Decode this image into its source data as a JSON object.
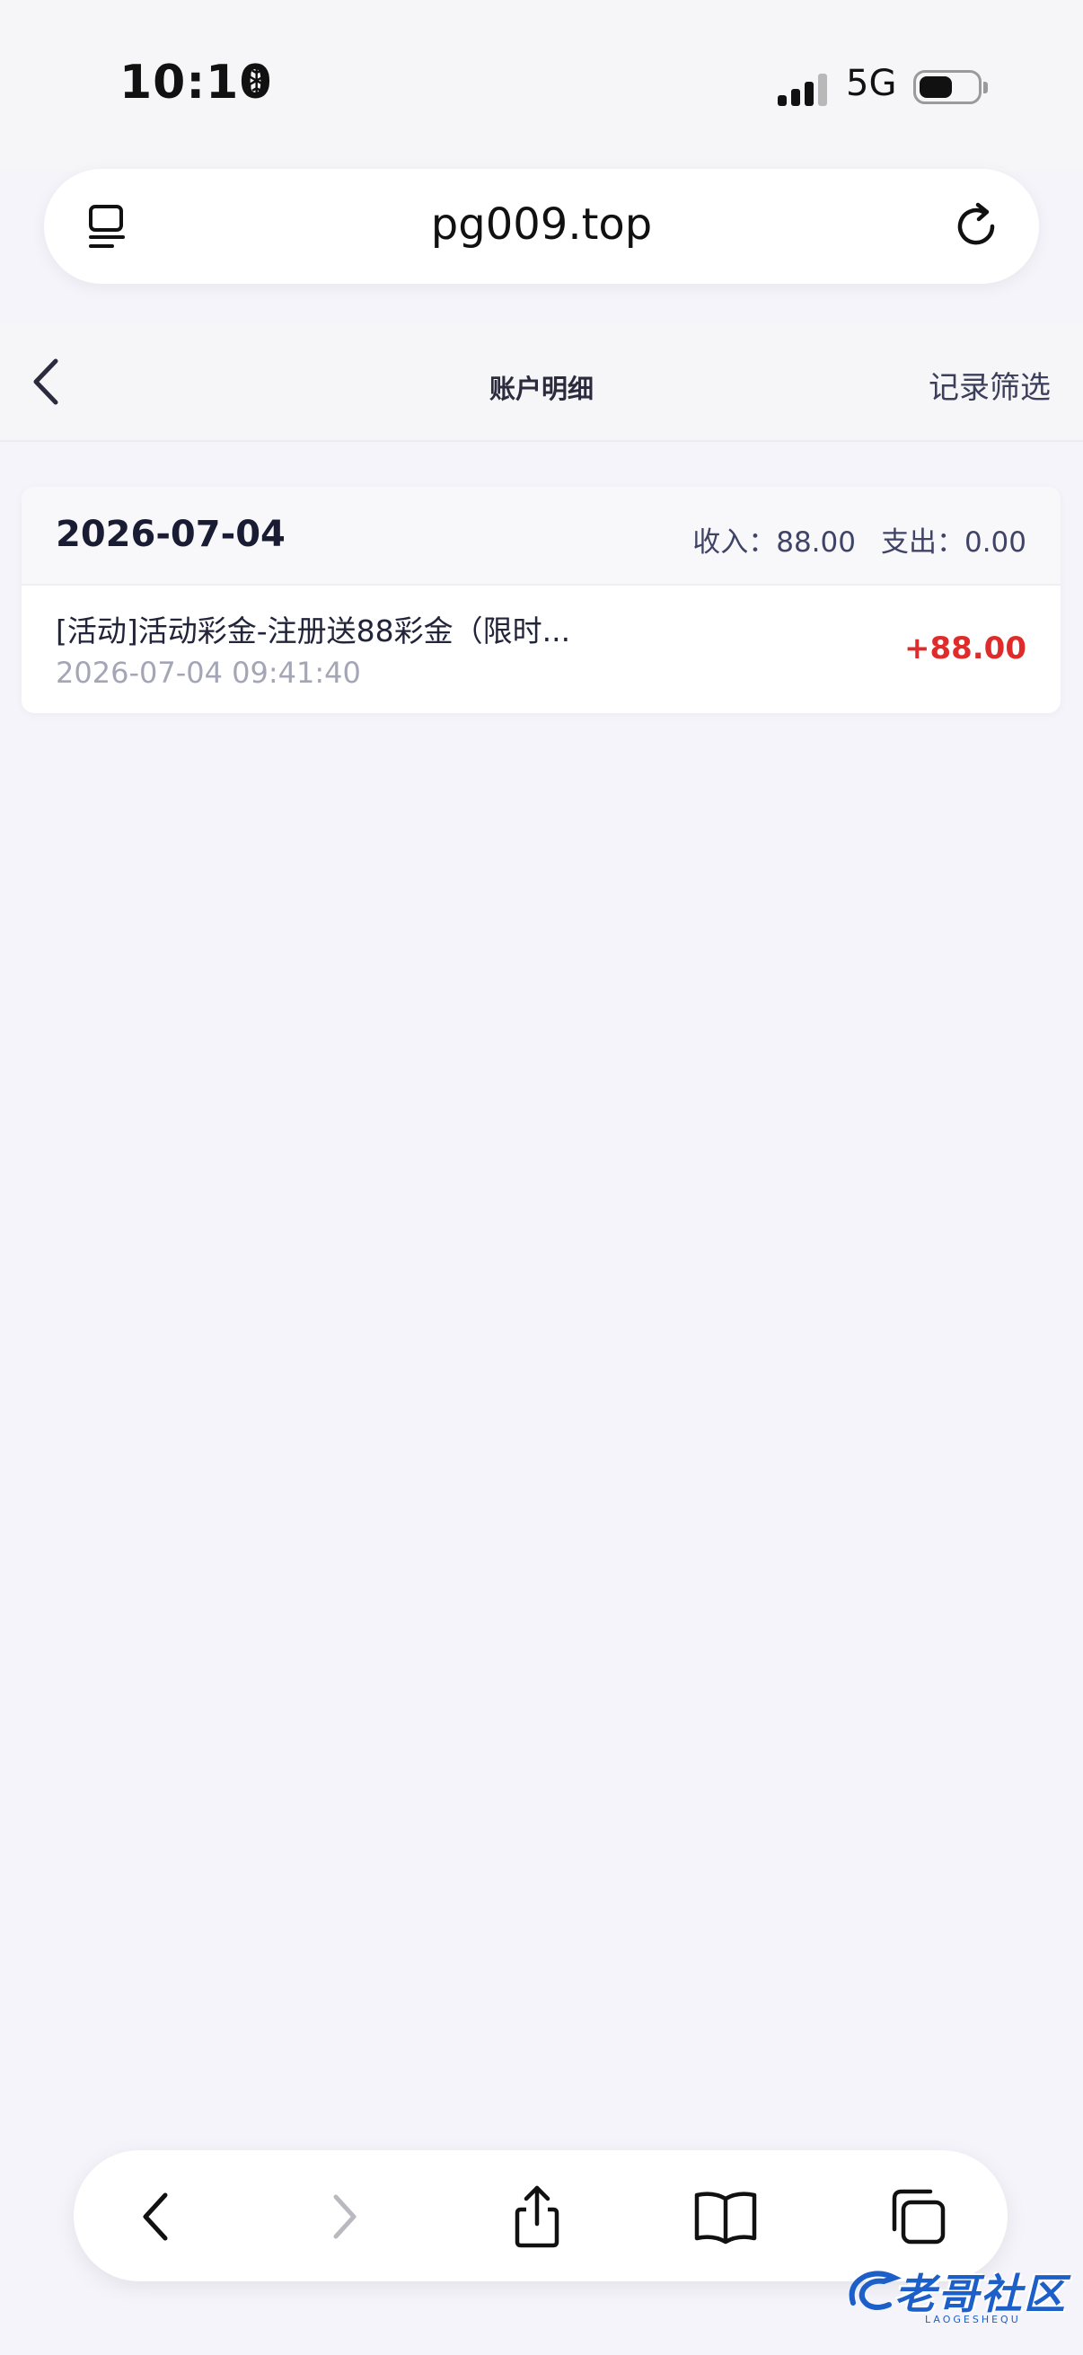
{
  "status_bar": {
    "time": "10:10",
    "extra_icon": "❄",
    "network": "5G",
    "battery_level": 0.5
  },
  "browser": {
    "url": "pg009.top"
  },
  "nav": {
    "title": "账户明细",
    "filter_label": "记录筛选"
  },
  "records": {
    "date": "2026-07-04",
    "income_label": "收入：",
    "income_value": "88.00",
    "expense_label": "支出：",
    "expense_value": "0.00",
    "items": [
      {
        "title": "[活动]活动彩金-注册送88彩金（限时...",
        "time": "2026-07-04 09:41:40",
        "amount": "+88.00"
      }
    ]
  },
  "toolbar": {
    "buttons": [
      "back",
      "forward",
      "share",
      "bookmarks",
      "tabs"
    ]
  },
  "watermark": {
    "text": "老哥社区",
    "sub": "LAOGESHEQU"
  },
  "colors": {
    "background": "#f4f4fa",
    "amount_positive": "#e02b2b",
    "watermark": "#1d5fc9"
  }
}
